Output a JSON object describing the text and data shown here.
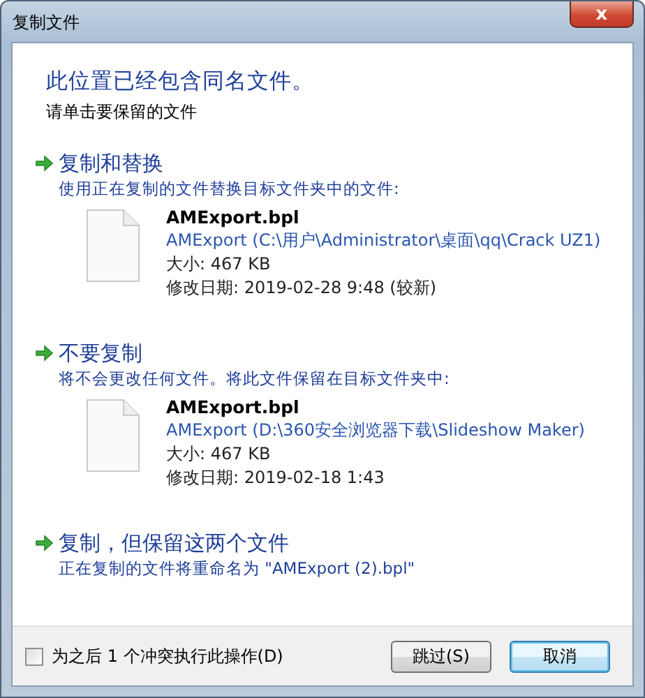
{
  "window": {
    "title": "复制文件",
    "close_label": "x"
  },
  "heading": "此位置已经包含同名文件。",
  "instruction": "请单击要保留的文件",
  "options": [
    {
      "kind": "file",
      "title": "复制和替换",
      "description": "使用正在复制的文件替换目标文件夹中的文件:",
      "file": {
        "name": "AMExport.bpl",
        "location": "AMExport (C:\\用户\\Administrator\\桌面\\qq\\Crack UZ1)",
        "size": "大小: 467 KB",
        "modified": "修改日期: 2019-02-28  9:48 (较新)"
      }
    },
    {
      "kind": "file",
      "title": "不要复制",
      "description": "将不会更改任何文件。将此文件保留在目标文件夹中:",
      "file": {
        "name": "AMExport.bpl",
        "location": "AMExport (D:\\360安全浏览器下载\\Slideshow Maker)",
        "size": "大小: 467 KB",
        "modified": "修改日期: 2019-02-18  1:43"
      }
    },
    {
      "kind": "rename",
      "title": "复制，但保留这两个文件",
      "description": "正在复制的文件将重命名为 \"AMExport (2).bpl\""
    }
  ],
  "footer": {
    "checkbox": {
      "label": "为之后 1 个冲突执行此操作(D)",
      "checked": false
    },
    "buttons": [
      {
        "label": "跳过(S)",
        "focused": false
      },
      {
        "label": "取消",
        "focused": true
      }
    ]
  }
}
